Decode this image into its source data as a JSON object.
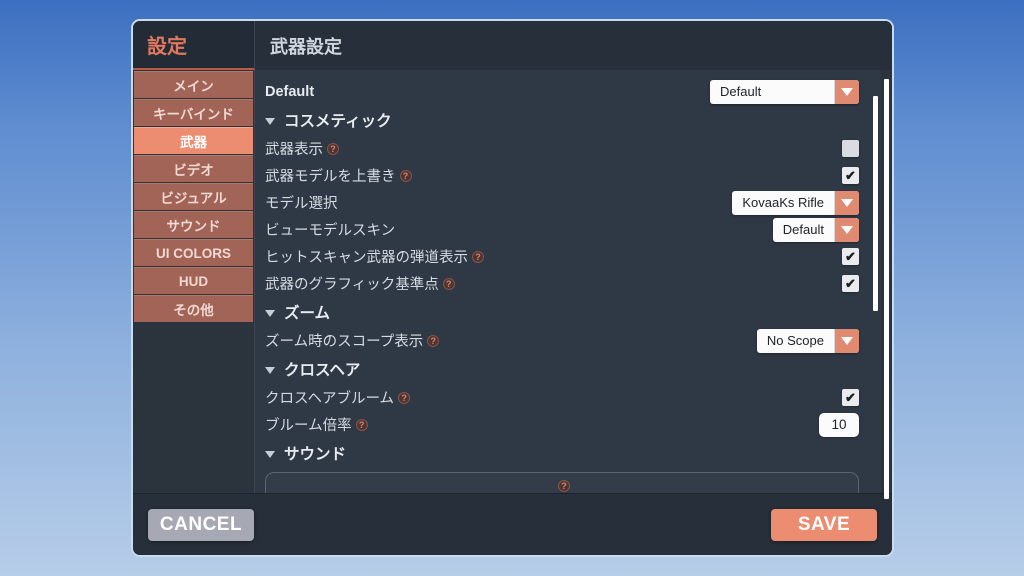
{
  "window": {
    "sidebar_title": "設定",
    "page_title": "武器設定",
    "accent_color": "#ec8d72",
    "sidebar_item_color": "#a26457",
    "panel_bg_color": "#2f3845"
  },
  "sidebar": {
    "items": [
      {
        "label": "メイン",
        "active": false
      },
      {
        "label": "キーバインド",
        "active": false
      },
      {
        "label": "武器",
        "active": true
      },
      {
        "label": "ビデオ",
        "active": false
      },
      {
        "label": "ビジュアル",
        "active": false
      },
      {
        "label": "サウンド",
        "active": false
      },
      {
        "label": "UI COLORS",
        "active": false
      },
      {
        "label": "HUD",
        "active": false
      },
      {
        "label": "その他",
        "active": false
      }
    ]
  },
  "main": {
    "preset_row": {
      "label": "Default",
      "dropdown_value": "Default"
    },
    "sections": [
      {
        "title": "コスメティック",
        "expanded": true,
        "rows": [
          {
            "label": "武器表示",
            "help": true,
            "control": "checkbox",
            "checked": false
          },
          {
            "label": "武器モデルを上書き",
            "help": true,
            "control": "checkbox",
            "checked": true
          },
          {
            "label": "モデル選択",
            "help": false,
            "control": "dropdown",
            "value": "KovaaKs Rifle"
          },
          {
            "label": "ビューモデルスキン",
            "help": false,
            "control": "dropdown",
            "value": "Default"
          },
          {
            "label": "ヒットスキャン武器の弾道表示",
            "help": true,
            "control": "checkbox",
            "checked": true
          },
          {
            "label": "武器のグラフィック基準点",
            "help": true,
            "control": "checkbox",
            "checked": true
          }
        ]
      },
      {
        "title": "ズーム",
        "expanded": true,
        "rows": [
          {
            "label": "ズーム時のスコープ表示",
            "help": true,
            "control": "dropdown",
            "value": "No Scope"
          }
        ]
      },
      {
        "title": "クロスヘア",
        "expanded": true,
        "rows": [
          {
            "label": "クロスヘアブルーム",
            "help": true,
            "control": "checkbox",
            "checked": true
          },
          {
            "label": "ブルーム倍率",
            "help": true,
            "control": "number",
            "value": "10"
          }
        ]
      },
      {
        "title": "サウンド",
        "expanded": true,
        "rows": []
      }
    ],
    "checkbox_checked_glyph": "✔",
    "help_glyph": "?"
  },
  "footer": {
    "cancel_label": "CANCEL",
    "save_label": "SAVE"
  }
}
